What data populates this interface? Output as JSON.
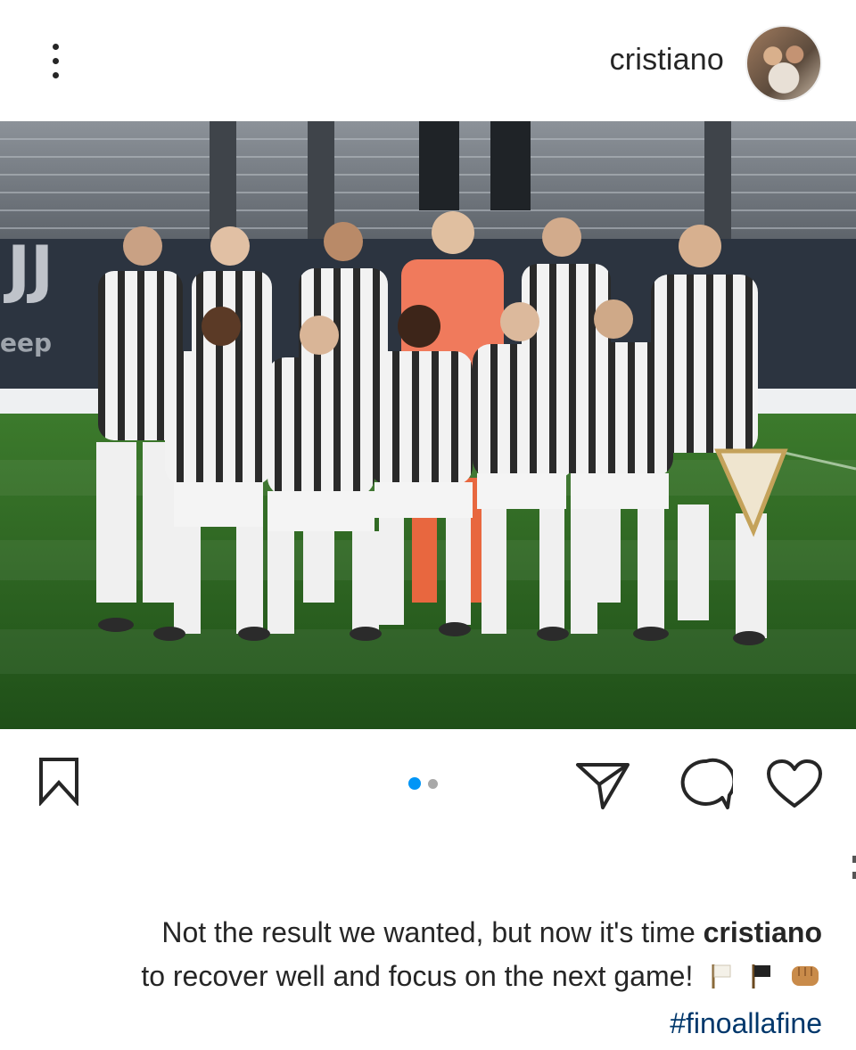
{
  "header": {
    "username": "cristiano"
  },
  "post": {
    "carousel": {
      "total": 2,
      "active": 1
    }
  },
  "caption": {
    "text": "Not the result we wanted, but now it's time",
    "author": "cristiano",
    "text2": "to recover well and focus on the next game!",
    "emojis": [
      "white-flag",
      "black-flag",
      "fist"
    ],
    "hashtag": "#finoallafine"
  },
  "colors": {
    "accent": "#0095f6",
    "hashtag": "#00376b",
    "text": "#262626"
  },
  "icons": {
    "more": "more-vertical-icon",
    "bookmark": "bookmark-icon",
    "share": "send-icon",
    "comment": "comment-icon",
    "like": "heart-icon"
  }
}
